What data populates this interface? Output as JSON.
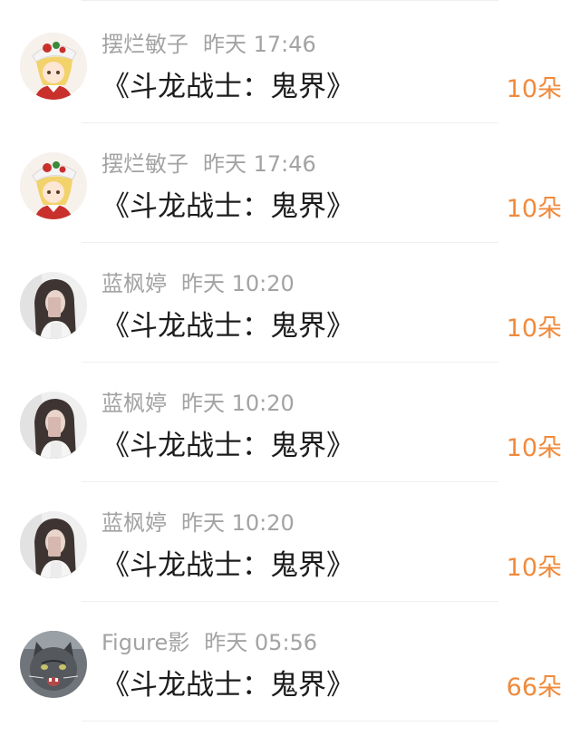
{
  "gift_list": [
    {
      "avatar": "anime-girl-avatar",
      "username": "摆烂敏子",
      "time": "昨天 17:46",
      "gift": "《斗龙战士：鬼界》",
      "count": "10朵"
    },
    {
      "avatar": "anime-girl-avatar",
      "username": "摆烂敏子",
      "time": "昨天 17:46",
      "gift": "《斗龙战士：鬼界》",
      "count": "10朵"
    },
    {
      "avatar": "girl-photo-avatar",
      "username": "蓝枫婷",
      "time": "昨天 10:20",
      "gift": "《斗龙战士：鬼界》",
      "count": "10朵"
    },
    {
      "avatar": "girl-photo-avatar",
      "username": "蓝枫婷",
      "time": "昨天 10:20",
      "gift": "《斗龙战士：鬼界》",
      "count": "10朵"
    },
    {
      "avatar": "girl-photo-avatar",
      "username": "蓝枫婷",
      "time": "昨天 10:20",
      "gift": "《斗龙战士：鬼界》",
      "count": "10朵"
    },
    {
      "avatar": "cat-photo-avatar",
      "username": "Figure影",
      "time": "昨天 05:56",
      "gift": "《斗龙战士：鬼界》",
      "count": "66朵"
    }
  ],
  "colors": {
    "count_accent": "#f08a3c",
    "meta_text": "#a3a3a3",
    "gift_text": "#1c1c1c",
    "divider": "#efefef"
  }
}
